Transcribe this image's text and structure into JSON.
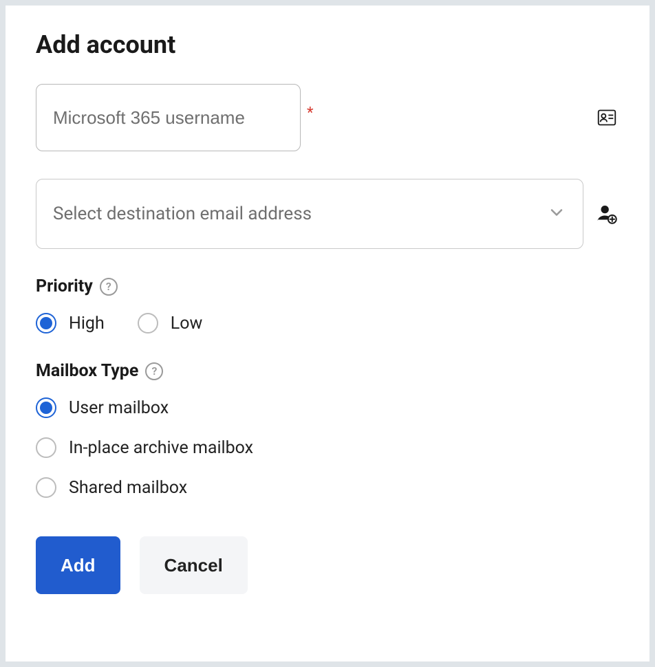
{
  "title": "Add account",
  "username_field": {
    "placeholder": "Microsoft 365 username",
    "required": true
  },
  "destination_select": {
    "placeholder": "Select destination email address"
  },
  "priority": {
    "label": "Priority",
    "options": [
      {
        "label": "High",
        "selected": true
      },
      {
        "label": "Low",
        "selected": false
      }
    ]
  },
  "mailbox_type": {
    "label": "Mailbox Type",
    "options": [
      {
        "label": "User mailbox",
        "selected": true
      },
      {
        "label": "In-place archive mailbox",
        "selected": false
      },
      {
        "label": "Shared mailbox",
        "selected": false
      }
    ]
  },
  "buttons": {
    "add": "Add",
    "cancel": "Cancel"
  }
}
